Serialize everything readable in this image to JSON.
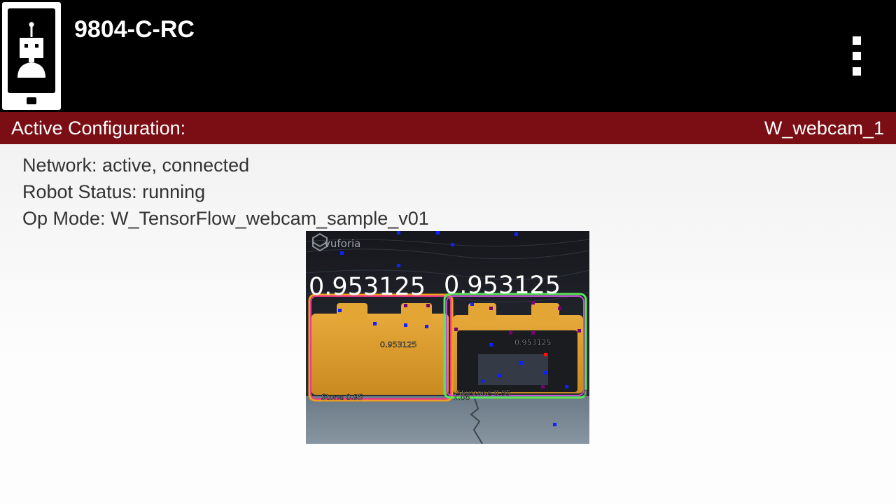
{
  "app": {
    "title": "9804-C-RC"
  },
  "config": {
    "label": "Active Configuration:",
    "value": "W_webcam_1"
  },
  "status": {
    "network": "Network: active, connected",
    "robot": "Robot Status: running",
    "op_mode": "Op Mode: W_TensorFlow_webcam_sample_v01"
  },
  "camera": {
    "watermark": "vuforia",
    "detections": [
      {
        "confidence": "0.953125",
        "center_score": "0.953125",
        "label": "Stone 0.95",
        "box_color": "#f0a020"
      },
      {
        "confidence": "0.953125",
        "center_score": "0.953125",
        "label": "Skystone 0.95",
        "box_color": "#5ae65a"
      }
    ],
    "edge_labels": [
      "1.00",
      "1"
    ]
  },
  "colors": {
    "app_bar": "#000000",
    "config_bar": "#7a0e14",
    "status_text": "#333333"
  },
  "icons": {
    "logo": "robot-phone-icon",
    "menu": "overflow-menu-icon"
  }
}
